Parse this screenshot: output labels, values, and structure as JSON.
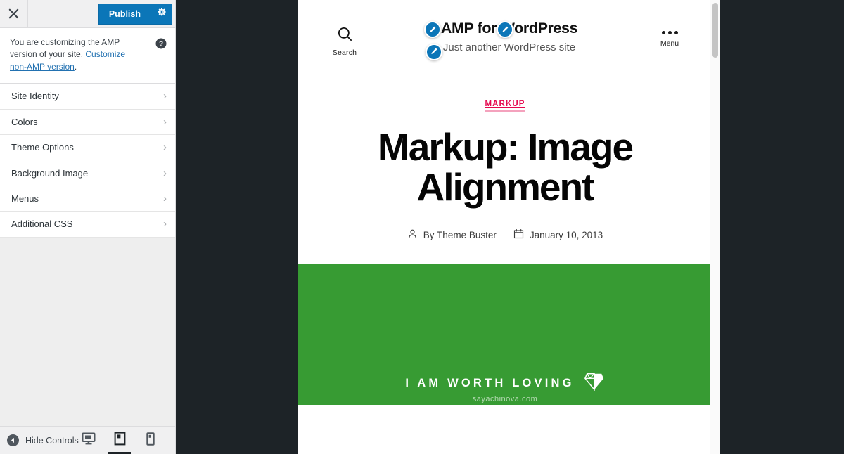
{
  "customizer": {
    "close_label": "Close customizer",
    "publish_label": "Publish",
    "gear_label": "Publish settings",
    "notice": {
      "text_before": "You are customizing the AMP version of your site. ",
      "link_text": "Customize non-AMP version",
      "text_after": ".",
      "help_label": "Help"
    },
    "items": [
      {
        "label": "Site Identity",
        "chevron": "›"
      },
      {
        "label": "Colors",
        "chevron": "›"
      },
      {
        "label": "Theme Options",
        "chevron": "›"
      },
      {
        "label": "Background Image",
        "chevron": "›"
      },
      {
        "label": "Menus",
        "chevron": "›"
      },
      {
        "label": "Additional CSS",
        "chevron": "›"
      }
    ],
    "footer": {
      "hide_controls_label": "Hide Controls",
      "devices": [
        {
          "name": "desktop",
          "label": "Enter desktop preview mode",
          "active": false
        },
        {
          "name": "tablet",
          "label": "Enter tablet preview mode",
          "active": true
        },
        {
          "name": "mobile",
          "label": "Enter mobile preview mode",
          "active": false
        }
      ]
    },
    "colors": {
      "publish_blue": "#0b76b8",
      "link_blue": "#2271b1",
      "sidebar_bg": "#eeeeee"
    }
  },
  "preview": {
    "site_header": {
      "search_label": "Search",
      "site_title": "AMP for WordPress",
      "tagline": "Just another WordPress site",
      "menu_label": "Menu"
    },
    "post": {
      "category": "MARKUP",
      "title": "Markup: Image Alignment",
      "author": "By Theme Buster",
      "date": "January 10, 2013"
    },
    "featured_image": {
      "text": "I AM WORTH LOVING",
      "url_text": "sayachinova.com",
      "background_color": "#379b33",
      "logo": "diamond-heart-icon"
    },
    "edit_badges": [
      {
        "name": "edit-site-title",
        "label": "Edit site title"
      },
      {
        "name": "edit-site-title-2",
        "label": "Edit site title"
      },
      {
        "name": "edit-tagline",
        "label": "Edit tagline"
      }
    ],
    "background_color": "#1d2327"
  }
}
